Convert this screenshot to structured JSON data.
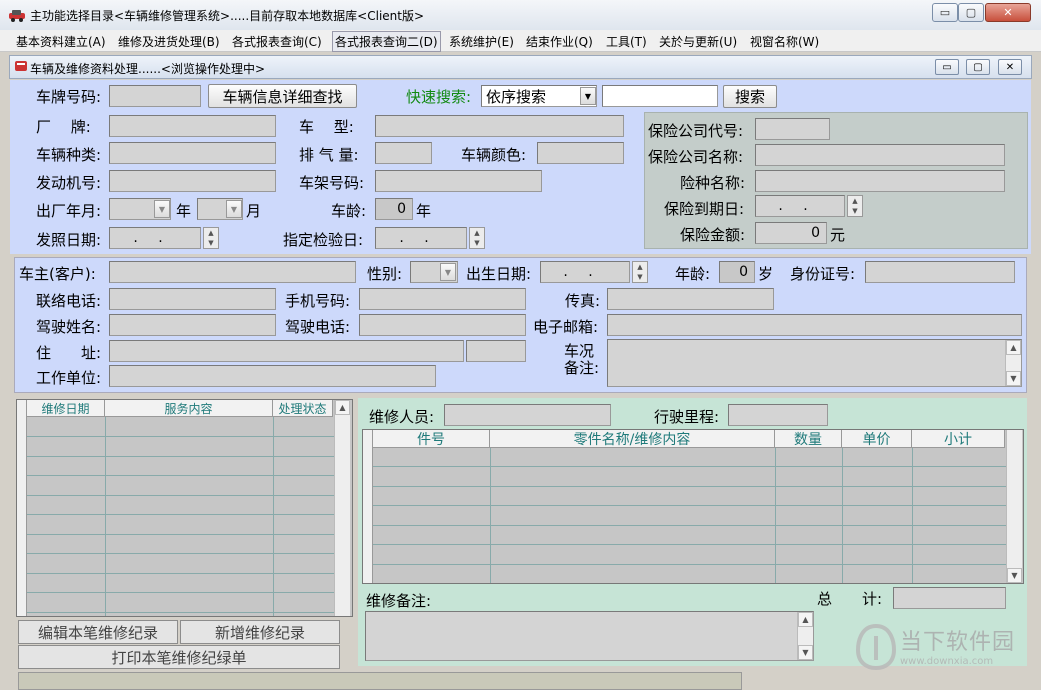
{
  "window": {
    "title": "主功能选择目录<车辆维修管理系统>.....目前存取本地数据库<Client版>",
    "min": "▭",
    "max": "▢",
    "close": "✕"
  },
  "menu": [
    "基本资料建立(A)",
    "维修及进货处理(B)",
    "各式报表查询(C)",
    "各式报表查询二(D)",
    "系统维护(E)",
    "结束作业(Q)",
    "工具(T)",
    "关於与更新(U)",
    "视窗名称(W)"
  ],
  "child": {
    "title": "车辆及维修资料处理......<浏览操作处理中>"
  },
  "vehicle": {
    "plate_label": "车牌号码:",
    "detail_btn": "车辆信息详细查找",
    "quick_label": "快速搜索:",
    "quick_option": "依序搜索",
    "search_btn": "搜索",
    "brand_label": "厂　 牌:",
    "model_label": "车　 型:",
    "type_label": "车辆种类:",
    "displacement_label": "排 气 量:",
    "color_label": "车辆颜色:",
    "engine_label": "发动机号:",
    "frame_label": "车架号码:",
    "made_label": "出厂年月:",
    "year_unit": "年",
    "month_unit": "月",
    "age_label": "车龄:",
    "age_value": "0",
    "age_unit": "年",
    "license_label": "发照日期:",
    "license_value": ". .",
    "inspect_label": "指定检验日:",
    "inspect_value": ". ."
  },
  "insurance": {
    "code_label": "保险公司代号:",
    "name_label": "保险公司名称:",
    "type_label": "险种名称:",
    "expire_label": "保险到期日:",
    "expire_value": ". .",
    "amount_label": "保险金额:",
    "amount_value": "0",
    "amount_unit": "元"
  },
  "owner": {
    "owner_label": "车主(客户):",
    "gender_label": "性别:",
    "birth_label": "出生日期:",
    "birth_value": ". .",
    "age_label": "年龄:",
    "age_value": "0",
    "age_unit": "岁",
    "id_label": "身份证号:",
    "phone_label": "联络电话:",
    "mobile_label": "手机号码:",
    "fax_label": "传真:",
    "driver_label": "驾驶姓名:",
    "driver_phone_label": "驾驶电话:",
    "email_label": "电子邮箱:",
    "address_label": "住　　址:",
    "condition_label": "车况",
    "remark_label": "备注:",
    "work_label": "工作单位:"
  },
  "repair_list": {
    "headers": [
      "维修日期",
      "服务内容",
      "处理状态"
    ]
  },
  "repair_detail": {
    "staff_label": "维修人员:",
    "mileage_label": "行驶里程:",
    "headers": [
      "件号",
      "零件名称/维修内容",
      "数量",
      "单价",
      "小计"
    ],
    "remark_label": "维修备注:",
    "total_label": "总　　计:"
  },
  "buttons": {
    "edit": "编辑本笔维修纪录",
    "add": "新增维修纪录",
    "print": "打印本笔维修纪绿单"
  },
  "watermark": {
    "text": "当下软件园",
    "url": "www.downxia.com"
  }
}
